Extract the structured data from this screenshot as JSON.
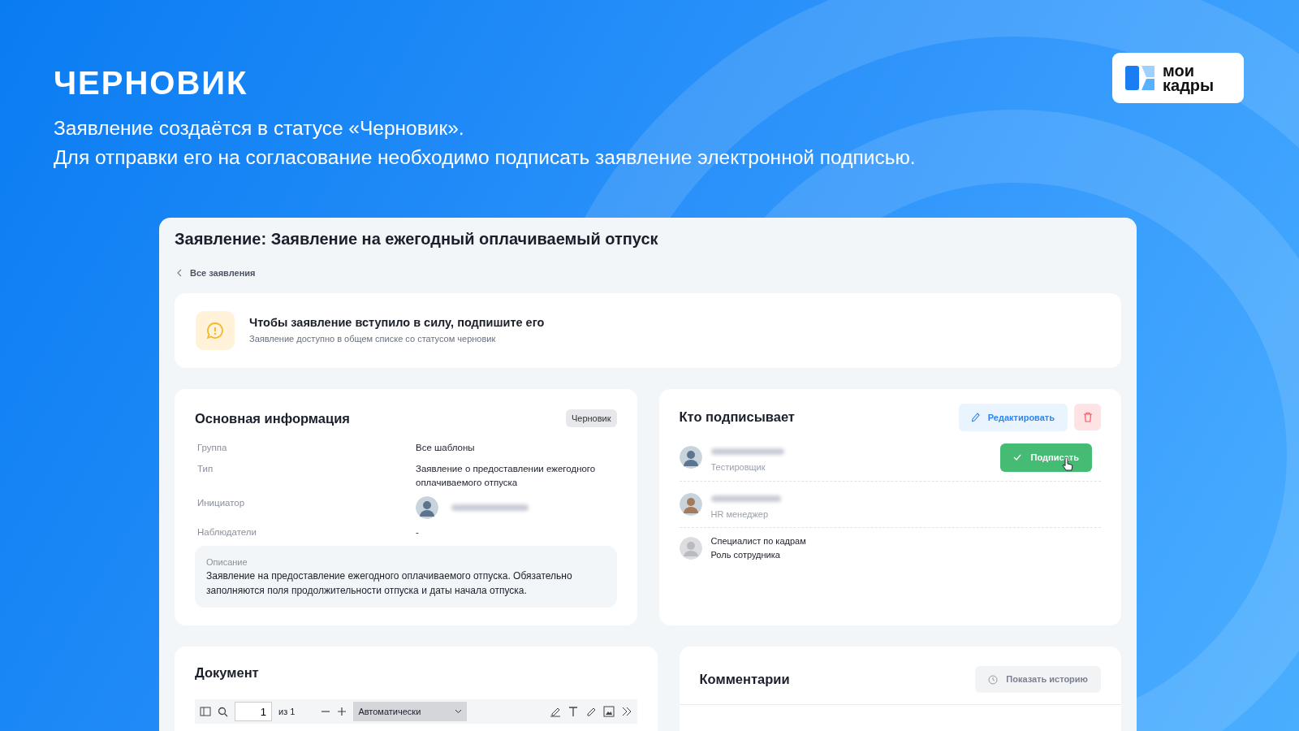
{
  "hero": {
    "title": "ЧЕРНОВИК",
    "lines": [
      "Заявление создаётся в статусе «Черновик».",
      "Для отправки его на согласование необходимо подписать заявление электронной подписью."
    ]
  },
  "logo": {
    "lines": [
      "мои",
      "кадры"
    ]
  },
  "window": {
    "title": "Заявление: Заявление на ежегодный оплачиваемый отпуск",
    "back_link": "Все заявления"
  },
  "alert": {
    "title": "Чтобы заявление вступило в силу, подпишите его",
    "text": "Заявление доступно в общем списке со статусом черновик"
  },
  "info": {
    "title": "Основная информация",
    "status": "Черновик",
    "fields": [
      {
        "label": "Группа",
        "kind": "text",
        "value": "Все шаблоны"
      },
      {
        "label": "Тип",
        "kind": "text",
        "value": "Заявление о предоставлении ежегодного оплачиваемого отпуска"
      },
      {
        "label": "Инициатор",
        "kind": "person"
      },
      {
        "label": "Наблюдатели",
        "kind": "text",
        "value": "-"
      }
    ],
    "description": {
      "label": "Описание",
      "text": "Заявление на предоставление ежегодного оплачиваемого отпуска. Обязательно заполняются поля продолжительности отпуска и даты начала отпуска."
    }
  },
  "signers": {
    "title": "Кто подписывает",
    "edit_button": "Редактировать",
    "sign_button": "Подписать",
    "items": [
      {
        "kind": "person",
        "role": "Тестировщик",
        "can_sign": true
      },
      {
        "kind": "person",
        "role": "HR менеджер",
        "can_sign": false
      },
      {
        "kind": "role",
        "name": "Специалист по кадрам",
        "role": "Роль сотрудника",
        "can_sign": false
      }
    ]
  },
  "document": {
    "title": "Документ",
    "page": "1",
    "page_count": "из 1",
    "zoom": "Автоматически"
  },
  "comments": {
    "title": "Комментарии",
    "history_button": "Показать историю"
  }
}
